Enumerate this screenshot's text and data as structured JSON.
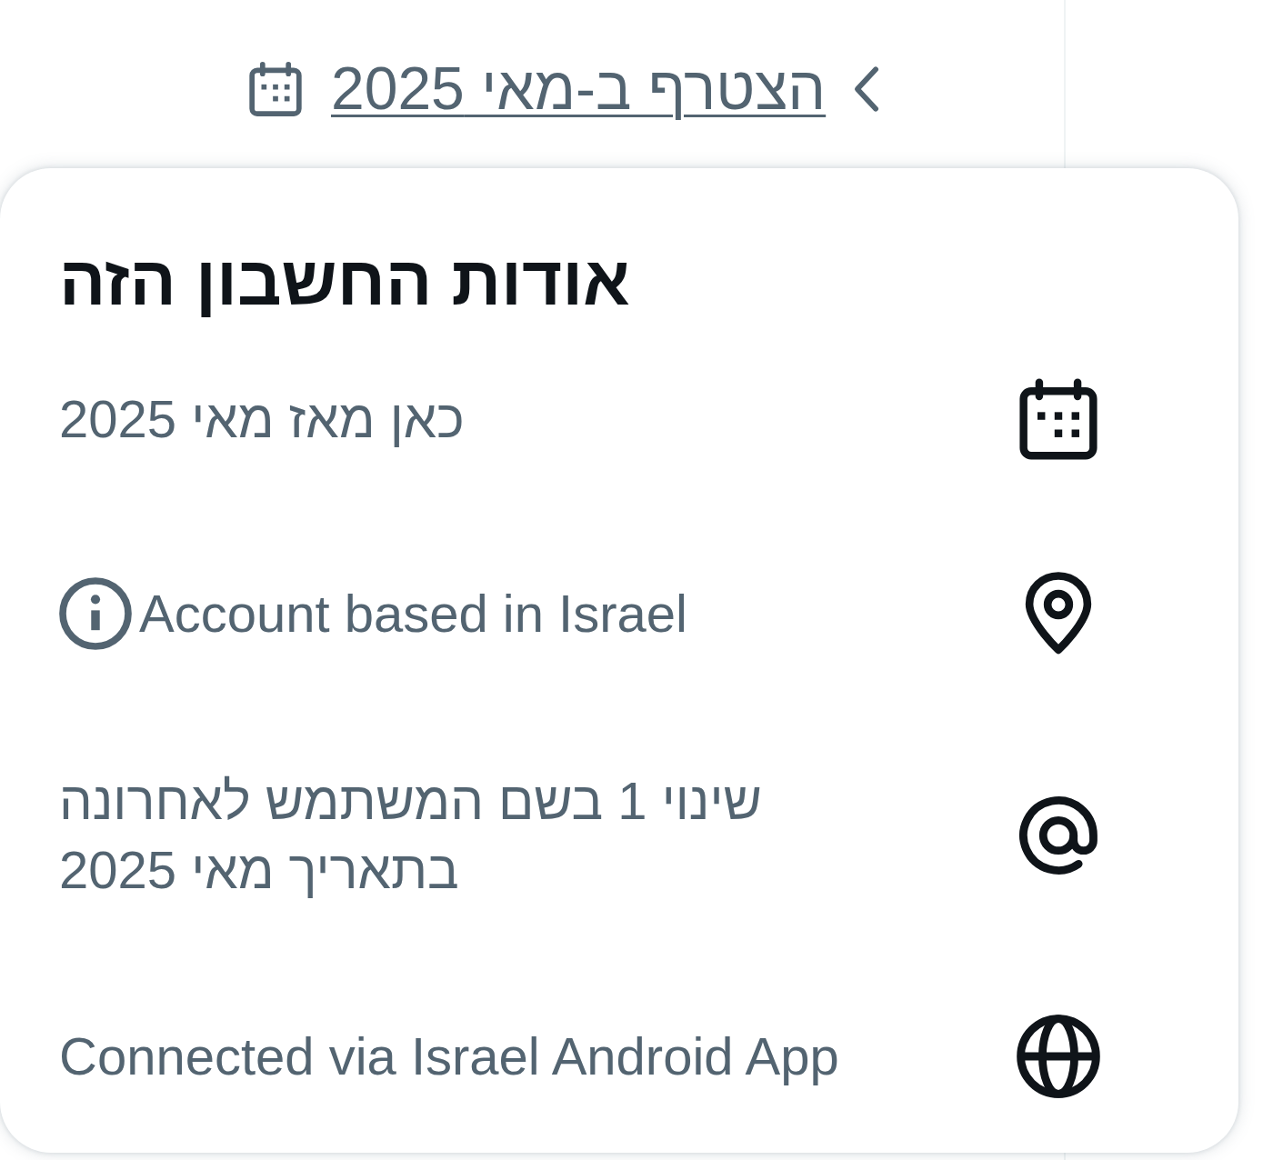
{
  "profile_meta": {
    "joined": "הצטרף ב-מאי 2025"
  },
  "about_popup": {
    "title": "אודות החשבון הזה",
    "rows": [
      {
        "kind": "date",
        "text": "כאן מאז מאי 2025"
      },
      {
        "kind": "location",
        "text": "Account based in Israel",
        "info_icon": true
      },
      {
        "kind": "username",
        "text": "שינוי 1 בשם המשתמש לאחרונה בתאריך מאי 2025"
      },
      {
        "kind": "connection",
        "text": "Connected via Israel Android App"
      }
    ]
  }
}
